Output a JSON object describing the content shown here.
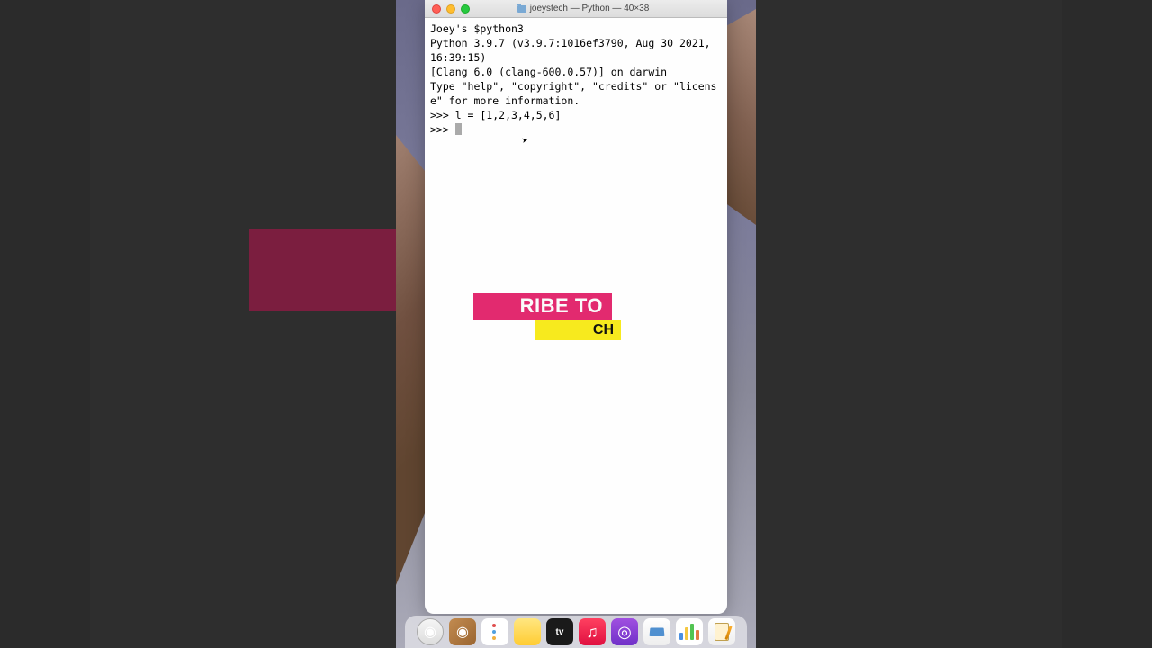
{
  "window": {
    "title": "joeystech — Python — 40×38"
  },
  "terminal": {
    "line1": "Joey's $python3",
    "line2": "Python 3.9.7 (v3.9.7:1016ef3790, Aug 30 2021, 16:39:15)",
    "line3": "[Clang 6.0 (clang-600.0.57)] on darwin",
    "line4": "Type \"help\", \"copyright\", \"credits\" or \"license\" for more information.",
    "line5": ">>> l = [1,2,3,4,5,6]",
    "prompt": ">>> "
  },
  "overlay": {
    "top": "RIBE TO",
    "bottom": "CH"
  },
  "dock": {
    "item5_label": "tv"
  }
}
